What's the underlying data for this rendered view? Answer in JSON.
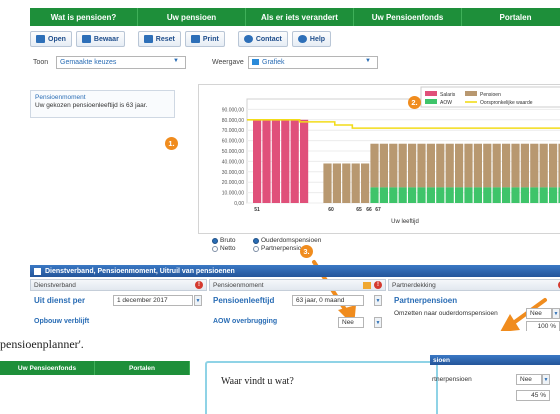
{
  "nav": [
    "Wat is pensioen?",
    "Uw pensioen",
    "Als er iets verandert",
    "Uw Pensioenfonds",
    "Portalen"
  ],
  "toolbar": {
    "buttons": [
      {
        "label": "Open",
        "icon": "folder-icon",
        "color": "#2d6fb8"
      },
      {
        "label": "Bewaar",
        "icon": "save-icon",
        "color": "#2d6fb8"
      },
      {
        "label": "Reset",
        "icon": "reset-icon",
        "color": "#2d6fb8"
      },
      {
        "label": "Print",
        "icon": "print-icon",
        "color": "#2d6fb8"
      },
      {
        "label": "Contact",
        "icon": "phone-icon",
        "color": "#2d6fb8"
      },
      {
        "label": "Help",
        "icon": "help-icon",
        "color": "#2d6fb8"
      }
    ]
  },
  "filters": {
    "toon_label": "Toon",
    "toon_value": "Gemaakte keuzes",
    "weergave_label": "Weergave",
    "weergave_value": "Grafiek"
  },
  "info": {
    "title": "Pensioenmoment",
    "text": "Uw gekozen pensioenleeftijd is 63 jaar."
  },
  "markers": [
    "1.",
    "2.",
    "3."
  ],
  "radios": {
    "left": [
      {
        "label": "Bruto",
        "checked": true
      },
      {
        "label": "Netto",
        "checked": false
      }
    ],
    "right": [
      {
        "label": "Ouderdomspensioen",
        "checked": true
      },
      {
        "label": "Partnerpensioen",
        "checked": false
      }
    ]
  },
  "chart_data": {
    "type": "bar",
    "xlabel": "Uw leeftijd",
    "ylabel": "",
    "ylim": [
      0,
      100000
    ],
    "yticks": [
      "0,00",
      "10.000,00",
      "20.000,00",
      "30.000,00",
      "40.000,00",
      "50.000,00",
      "60.000,00",
      "70.000,00",
      "80.000,00",
      "90.000,00"
    ],
    "xticks": [
      "51",
      "60",
      "65",
      "66",
      "67"
    ],
    "legend": [
      {
        "name": "Salaris",
        "color": "#e0507a"
      },
      {
        "name": "Pensioen",
        "color": "#b89870"
      },
      {
        "name": "AOW",
        "color": "#3ec46a"
      },
      {
        "name": "Oorspronkelijke waarde",
        "color": "#f2dc1a"
      }
    ],
    "salaris": [
      80000,
      80000,
      80000,
      80000,
      80000,
      80000
    ],
    "pensioen": [
      38000,
      38000,
      38000,
      38000,
      38000,
      38000,
      38000,
      38000,
      38000,
      38000,
      38000,
      38000,
      38000,
      38000,
      38000,
      38000,
      38000,
      38000,
      38000,
      38000,
      38000,
      38000,
      38000,
      38000,
      38000,
      38000,
      38000,
      38000,
      38000,
      38000
    ],
    "pensioen_with_aow": [
      57000,
      57000,
      57000,
      57000,
      57000,
      57000,
      57000,
      57000,
      57000,
      57000,
      57000,
      57000,
      57000,
      57000,
      57000,
      57000,
      57000,
      57000,
      57000,
      57000,
      57000,
      57000,
      57000,
      57000,
      57000
    ],
    "aow": [
      15000,
      15000,
      15000,
      15000,
      15000,
      15000,
      15000,
      15000,
      15000,
      15000,
      15000,
      15000,
      15000,
      15000,
      15000,
      15000,
      15000,
      15000,
      15000,
      15000,
      15000,
      15000,
      15000,
      15000,
      15000
    ],
    "reference_line": [
      80000,
      80000,
      80000,
      80000,
      80000,
      80000,
      78000,
      78000,
      78000,
      78000,
      75000,
      75000,
      72000,
      72000,
      72000,
      72000,
      72000,
      72000,
      72000,
      72000,
      72000,
      72000,
      72000,
      72000,
      72000,
      72000,
      72000,
      72000,
      72000,
      72000,
      72000,
      72000,
      72000,
      72000,
      72000,
      72000
    ]
  },
  "panel": {
    "header": "Dienstverband, Pensioenmoment, Uitruil van pensioenen",
    "cols": [
      "Dienstverband",
      "Pensioenmoment",
      "Partnerdekking"
    ],
    "uit_dienst_label": "Uit dienst per",
    "uit_dienst_value": "1 december 2017",
    "pensioenleeftijd_label": "Pensioenleeftijd",
    "pensioenleeftijd_value": "63 jaar, 0 maand",
    "partner_label": "Partnerpensioen",
    "omzetten_text": "Omzetten naar ouderdomspensioen",
    "nee_value": "Nee",
    "pct_value": "100 %",
    "row2_left": "Opbouw verblijft",
    "row2_mid": "AOW overbrugging",
    "row2_mid_value": "Nee"
  },
  "overlay": {
    "title": "pensioenplanner'.",
    "mini_nav": [
      "Uw Pensioenfonds",
      "Portalen"
    ],
    "callout_title": "Waar vindt u wat?",
    "rp_header": "sioen",
    "rp_text": "rtnerpensioen",
    "rp_nee": "Nee",
    "rp_pct": "45 %"
  }
}
